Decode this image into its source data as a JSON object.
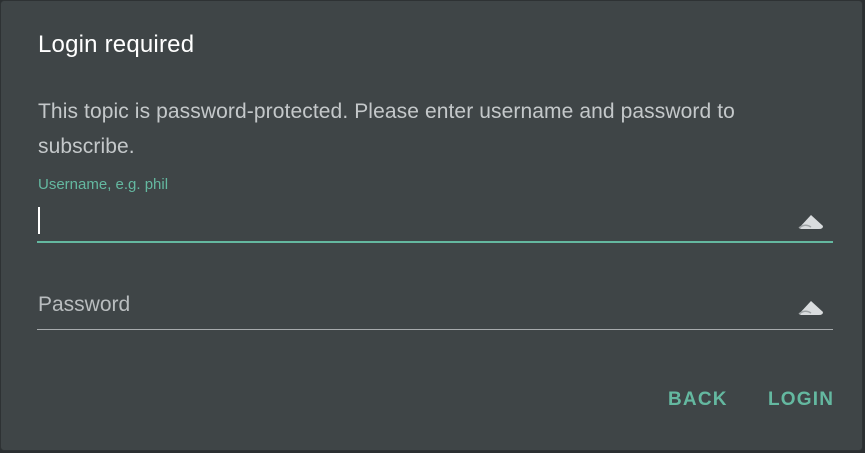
{
  "dialog": {
    "title": "Login required",
    "description": "This topic is password-protected. Please enter username and password to subscribe."
  },
  "fields": {
    "username": {
      "label": "Username, e.g. phil",
      "value": "",
      "icon": "autofill-icon"
    },
    "password": {
      "placeholder": "Password",
      "value": "",
      "icon": "autofill-icon"
    }
  },
  "actions": {
    "back_label": "BACK",
    "login_label": "LOGIN"
  },
  "colors": {
    "dialog_bg": "#3f4547",
    "accent": "#64b8a0",
    "title_text": "#ffffff",
    "body_text": "#c4c8ca"
  }
}
